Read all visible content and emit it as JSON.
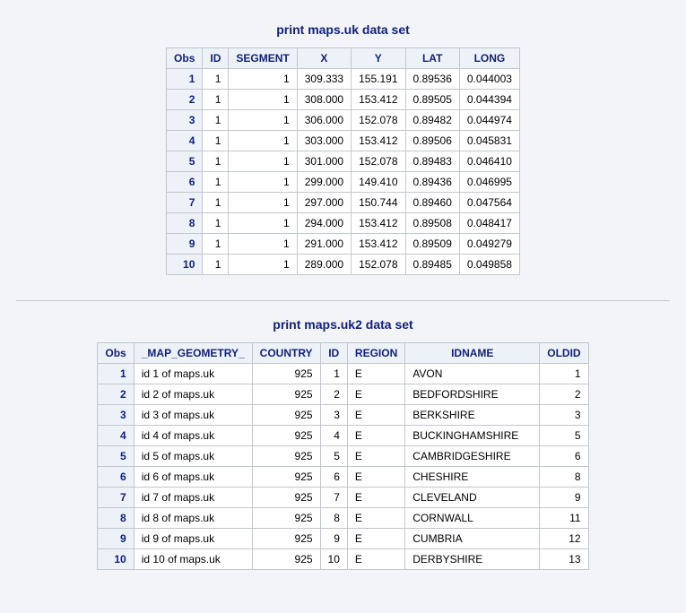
{
  "chart_data": [
    {
      "type": "table",
      "title": "print maps.uk data set",
      "columns": [
        "Obs",
        "ID",
        "SEGMENT",
        "X",
        "Y",
        "LAT",
        "LONG"
      ],
      "rows": [
        {
          "Obs": "1",
          "ID": "1",
          "SEGMENT": "1",
          "X": "309.333",
          "Y": "155.191",
          "LAT": "0.89536",
          "LONG": "0.044003"
        },
        {
          "Obs": "2",
          "ID": "1",
          "SEGMENT": "1",
          "X": "308.000",
          "Y": "153.412",
          "LAT": "0.89505",
          "LONG": "0.044394"
        },
        {
          "Obs": "3",
          "ID": "1",
          "SEGMENT": "1",
          "X": "306.000",
          "Y": "152.078",
          "LAT": "0.89482",
          "LONG": "0.044974"
        },
        {
          "Obs": "4",
          "ID": "1",
          "SEGMENT": "1",
          "X": "303.000",
          "Y": "153.412",
          "LAT": "0.89506",
          "LONG": "0.045831"
        },
        {
          "Obs": "5",
          "ID": "1",
          "SEGMENT": "1",
          "X": "301.000",
          "Y": "152.078",
          "LAT": "0.89483",
          "LONG": "0.046410"
        },
        {
          "Obs": "6",
          "ID": "1",
          "SEGMENT": "1",
          "X": "299.000",
          "Y": "149.410",
          "LAT": "0.89436",
          "LONG": "0.046995"
        },
        {
          "Obs": "7",
          "ID": "1",
          "SEGMENT": "1",
          "X": "297.000",
          "Y": "150.744",
          "LAT": "0.89460",
          "LONG": "0.047564"
        },
        {
          "Obs": "8",
          "ID": "1",
          "SEGMENT": "1",
          "X": "294.000",
          "Y": "153.412",
          "LAT": "0.89508",
          "LONG": "0.048417"
        },
        {
          "Obs": "9",
          "ID": "1",
          "SEGMENT": "1",
          "X": "291.000",
          "Y": "153.412",
          "LAT": "0.89509",
          "LONG": "0.049279"
        },
        {
          "Obs": "10",
          "ID": "1",
          "SEGMENT": "1",
          "X": "289.000",
          "Y": "152.078",
          "LAT": "0.89485",
          "LONG": "0.049858"
        }
      ]
    },
    {
      "type": "table",
      "title": "print maps.uk2 data set",
      "columns": [
        "Obs",
        "_MAP_GEOMETRY_",
        "COUNTRY",
        "ID",
        "REGION",
        "IDNAME",
        "OLDID"
      ],
      "rows": [
        {
          "Obs": "1",
          "_MAP_GEOMETRY_": "id 1 of maps.uk",
          "COUNTRY": "925",
          "ID": "1",
          "REGION": "E",
          "IDNAME": "AVON",
          "OLDID": "1"
        },
        {
          "Obs": "2",
          "_MAP_GEOMETRY_": "id 2 of maps.uk",
          "COUNTRY": "925",
          "ID": "2",
          "REGION": "E",
          "IDNAME": "BEDFORDSHIRE",
          "OLDID": "2"
        },
        {
          "Obs": "3",
          "_MAP_GEOMETRY_": "id 3 of maps.uk",
          "COUNTRY": "925",
          "ID": "3",
          "REGION": "E",
          "IDNAME": "BERKSHIRE",
          "OLDID": "3"
        },
        {
          "Obs": "4",
          "_MAP_GEOMETRY_": "id 4 of maps.uk",
          "COUNTRY": "925",
          "ID": "4",
          "REGION": "E",
          "IDNAME": "BUCKINGHAMSHIRE",
          "OLDID": "5"
        },
        {
          "Obs": "5",
          "_MAP_GEOMETRY_": "id 5 of maps.uk",
          "COUNTRY": "925",
          "ID": "5",
          "REGION": "E",
          "IDNAME": "CAMBRIDGESHIRE",
          "OLDID": "6"
        },
        {
          "Obs": "6",
          "_MAP_GEOMETRY_": "id 6 of maps.uk",
          "COUNTRY": "925",
          "ID": "6",
          "REGION": "E",
          "IDNAME": "CHESHIRE",
          "OLDID": "8"
        },
        {
          "Obs": "7",
          "_MAP_GEOMETRY_": "id 7 of maps.uk",
          "COUNTRY": "925",
          "ID": "7",
          "REGION": "E",
          "IDNAME": "CLEVELAND",
          "OLDID": "9"
        },
        {
          "Obs": "8",
          "_MAP_GEOMETRY_": "id 8 of maps.uk",
          "COUNTRY": "925",
          "ID": "8",
          "REGION": "E",
          "IDNAME": "CORNWALL",
          "OLDID": "11"
        },
        {
          "Obs": "9",
          "_MAP_GEOMETRY_": "id 9 of maps.uk",
          "COUNTRY": "925",
          "ID": "9",
          "REGION": "E",
          "IDNAME": "CUMBRIA",
          "OLDID": "12"
        },
        {
          "Obs": "10",
          "_MAP_GEOMETRY_": "id 10 of maps.uk",
          "COUNTRY": "925",
          "ID": "10",
          "REGION": "E",
          "IDNAME": "DERBYSHIRE",
          "OLDID": "13"
        }
      ]
    }
  ],
  "table1_idname_minwidth": "133"
}
